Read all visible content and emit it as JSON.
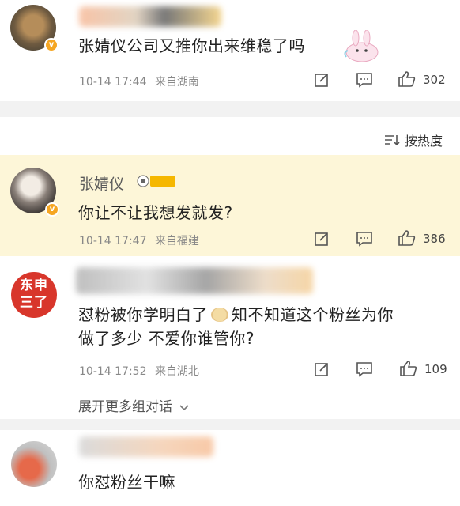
{
  "comments": [
    {
      "text": "张婧仪公司又推你出来维稳了吗",
      "time": "10-14 17:44",
      "location": "来自湖南",
      "likes": "302"
    },
    {
      "name": "张婧仪",
      "text": "你让不让我想发就发?",
      "time": "10-14 17:47",
      "location": "来自福建",
      "likes": "386"
    },
    {
      "avatar_text": "东申三了",
      "text_line1": "怼粉被你学明白了",
      "text_line1b": "知不知道这个粉丝为你",
      "text_line2": "做了多少 不爱你谁管你?",
      "time": "10-14 17:52",
      "location": "来自湖北",
      "likes": "109"
    },
    {
      "text": "你怼粉丝干嘛"
    }
  ],
  "sort_label": "按热度",
  "expand_label": "展开更多组对话",
  "colors": {
    "like": "#444444",
    "highlight_bg": "#fdf6d8",
    "badge": "#f5a623"
  },
  "icons": [
    "edit-icon",
    "comment-icon",
    "like-icon",
    "sort-icon",
    "chevron-down-icon"
  ]
}
